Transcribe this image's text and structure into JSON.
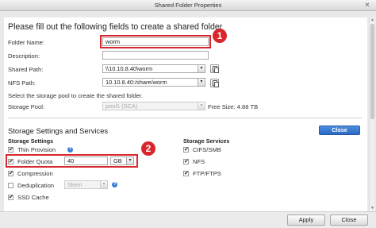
{
  "window": {
    "title": "Shared Folder Properties",
    "close_glyph": "×"
  },
  "main": {
    "heading": "Please fill out the following fields to create a shared folder",
    "folder_name": {
      "label": "Folder Name:",
      "value": "worm"
    },
    "description": {
      "label": "Description:",
      "value": ""
    },
    "shared_path": {
      "label": "Shared Path:",
      "value": "\\\\10.10.8.40\\worm"
    },
    "nfs_path": {
      "label": "NFS Path:",
      "value": "10.10.8.40:/share/worm"
    },
    "pool_note": "Select the storage pool to create the shared folder.",
    "storage_pool": {
      "label": "Storage Pool:",
      "value": "pool1 (SCA)",
      "free_size": "Free Size: 4.88 TB"
    }
  },
  "settings": {
    "heading": "Storage Settings and Services",
    "close_label": "Close",
    "storage_settings": {
      "title": "Storage Settings",
      "thin_provision": "Thin Provision",
      "folder_quota": {
        "label": "Folder Quota",
        "value": "40",
        "unit": "GB"
      },
      "compression": "Compression",
      "deduplication": {
        "label": "Deduplication",
        "value": "Skein"
      },
      "ssd_cache": "SSD Cache"
    },
    "storage_services": {
      "title": "Storage Services",
      "items": [
        "CIFS/SMB",
        "NFS",
        "FTP/FTPS"
      ]
    }
  },
  "annotations": {
    "badge1": "1",
    "badge2": "2"
  },
  "footer": {
    "apply_label": "Apply",
    "close_label": "Close"
  },
  "colors": {
    "accent": "#2a68c2",
    "highlight": "#d8262d"
  },
  "icons": {
    "check": "✔",
    "help": "?",
    "dropdown": "▾",
    "copy": "copy-icon"
  }
}
